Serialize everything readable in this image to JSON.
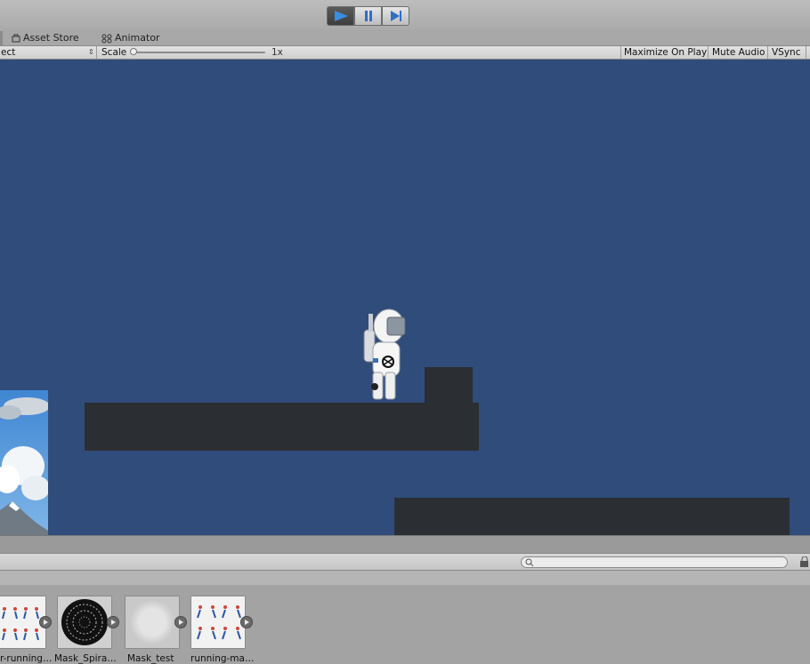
{
  "toolbar": {
    "play": "play-icon",
    "pause": "pause-icon",
    "step": "step-icon"
  },
  "tabs": [
    {
      "label": "Asset Store",
      "icon": "store-icon"
    },
    {
      "label": "Animator",
      "icon": "animator-icon"
    }
  ],
  "game_view": {
    "aspect_label": "ect",
    "scale_label": "Scale",
    "scale_value": "1x",
    "maximize_on_play": "Maximize On Play",
    "mute_audio": "Mute Audio",
    "vsync": "VSync"
  },
  "scene": {
    "background_color": "#304c7a",
    "platform_color": "#2b2e33"
  },
  "project": {
    "search_value": "",
    "assets": [
      {
        "label": "r-running…",
        "kind": "sprite-sheet-runner"
      },
      {
        "label": "Mask_Spira…",
        "kind": "spiral-texture"
      },
      {
        "label": "Mask_test",
        "kind": "soft-circle-texture"
      },
      {
        "label": "running-ma…",
        "kind": "sprite-sheet-runner"
      }
    ]
  }
}
